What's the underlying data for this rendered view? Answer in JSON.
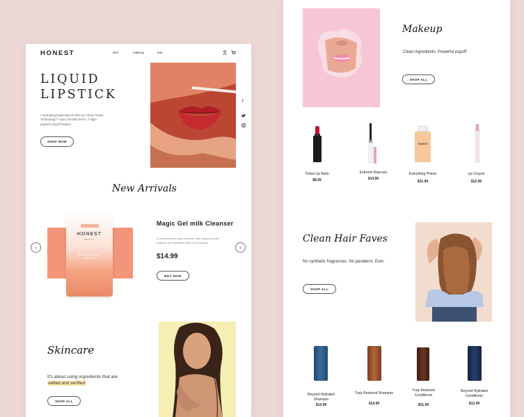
{
  "left_page": {
    "logo": "HONEST",
    "nav": [
      "skin",
      "makeup",
      "hair"
    ],
    "hero": {
      "title_line1": "LIQUID",
      "title_line2": "LIPSTICK",
      "description": "A hydrating liquid lipstick with our Clean Power Technology™ and a flexible feel in 7 high-pigment payoff shades",
      "cta": "SHOP NOW"
    },
    "new_arrivals": {
      "heading": "New Arrivals",
      "product_name": "Magic Gel milk Cleanser",
      "product_desc": "A transformative daily cleanser that easily removes makeup and impurities without overdrying",
      "price": "$14.99",
      "cta": "BUY NOW",
      "tube_brand": "HONEST",
      "tube_sub": "BEAUTY",
      "tube_label": "MAGIC GEL-TO-MILK CLEANSER"
    },
    "skincare": {
      "heading": "Skincare",
      "text_line1": "It's about using ingredients that are",
      "text_highlight": "vetted and verified",
      "cta": "SHOP ALL"
    }
  },
  "right_page": {
    "makeup": {
      "heading": "Makeup",
      "subtitle": "Clean ingredients. Powerful payoff",
      "cta": "SHOP ALL",
      "products": [
        {
          "name": "Tinted Lip Balm",
          "price": "$8.99"
        },
        {
          "name": "Extreme Mascara",
          "price": "$14.99"
        },
        {
          "name": "Everything Primer",
          "price": "$21.99"
        },
        {
          "name": "Lip Crayon",
          "price": "$12.99"
        }
      ],
      "primer_brand": "HONEST"
    },
    "hair": {
      "heading": "Clean Hair Faves",
      "subtitle": "No synthetic fragrances. No parabens. Ever.",
      "cta": "SHOP ALL",
      "products": [
        {
          "name": "Beyond Hydrated Shampoo",
          "price": "$14.99"
        },
        {
          "name": "Truly Restored Shampoo",
          "price": "$14.99"
        },
        {
          "name": "Truly Restored Conditioner",
          "price": "$21.99"
        },
        {
          "name": "Beyond Hydrated Conditioner",
          "price": "$12.99"
        }
      ]
    }
  },
  "colors": {
    "background": "#ecd7d6",
    "accent_coral": "#f2957a",
    "highlight": "#fbe8a6",
    "pink_photo": "#f7c6d4"
  },
  "icons": [
    "user-icon",
    "cart-icon",
    "facebook-icon",
    "twitter-icon",
    "instagram-icon",
    "chevron-left-icon",
    "chevron-right-icon"
  ]
}
